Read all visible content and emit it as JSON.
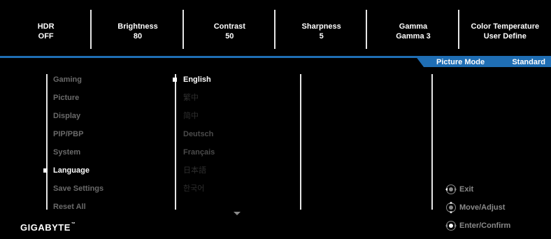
{
  "status": [
    {
      "label": "HDR",
      "value": "OFF"
    },
    {
      "label": "Brightness",
      "value": "80"
    },
    {
      "label": "Contrast",
      "value": "50"
    },
    {
      "label": "Sharpness",
      "value": "5"
    },
    {
      "label": "Gamma",
      "value": "Gamma 3"
    },
    {
      "label": "Color Temperature",
      "value": "User Define"
    }
  ],
  "picture_mode": {
    "label": "Picture Mode",
    "value": "Standard"
  },
  "main_menu": {
    "items": [
      "Gaming",
      "Picture",
      "Display",
      "PIP/PBP",
      "System",
      "Language",
      "Save Settings",
      "Reset All"
    ],
    "selected": "Language"
  },
  "language_menu": {
    "items": [
      "English",
      "繁中",
      "简中",
      "Deutsch",
      "Français",
      "日本語",
      "한국어"
    ],
    "selected": "English"
  },
  "hints": [
    {
      "icon": "joystick-icon",
      "label": "Exit"
    },
    {
      "icon": "joystick-icon",
      "label": "Move/Adjust"
    },
    {
      "icon": "joystick-icon",
      "label": "Enter/Confirm"
    }
  ],
  "brand": {
    "name": "GIGABYTE",
    "mark": "™"
  },
  "colors": {
    "accent": "#1f6eb4",
    "background": "#000000",
    "inactive_text": "#6a6a6a"
  }
}
